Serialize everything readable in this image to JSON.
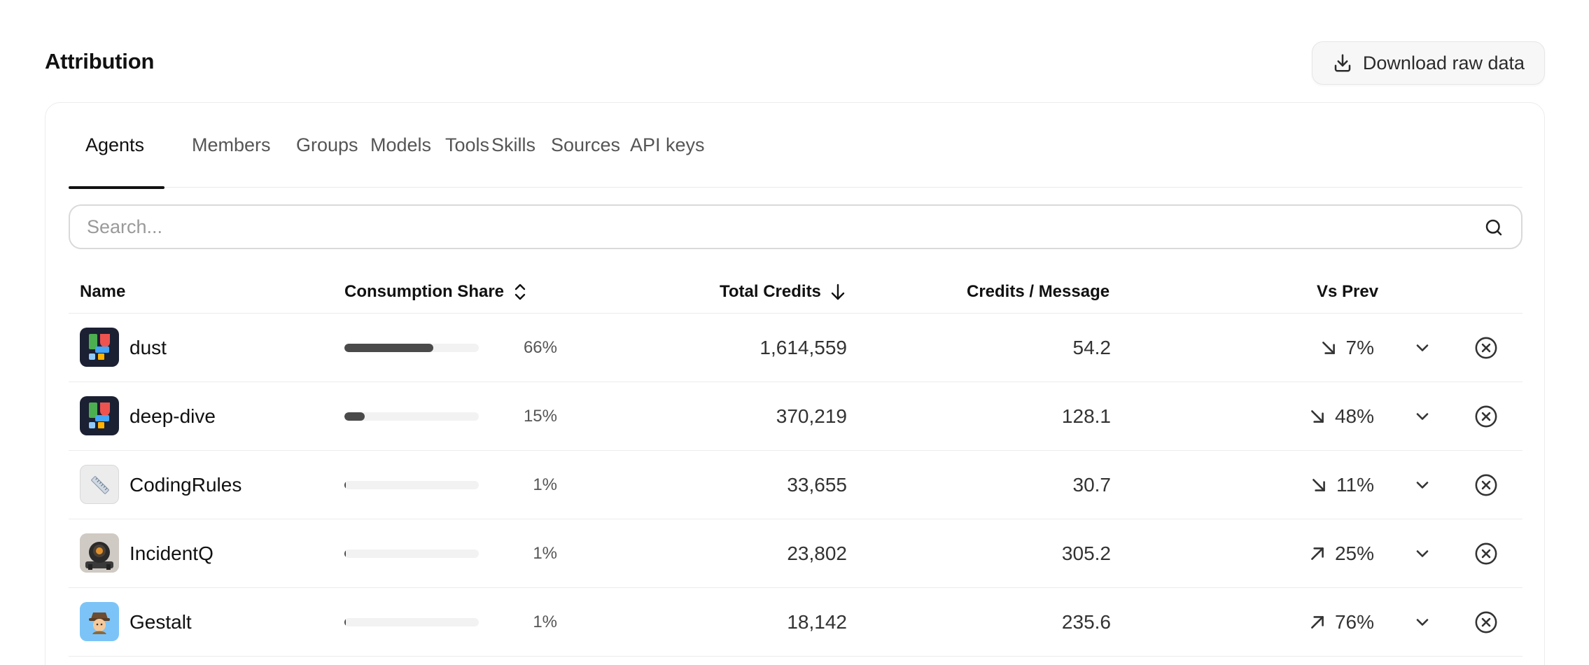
{
  "header": {
    "title": "Attribution",
    "download_label": "Download raw data"
  },
  "tabs": [
    {
      "label": "Agents",
      "active": true
    },
    {
      "label": "Members",
      "active": false
    },
    {
      "label": "Groups",
      "active": false
    },
    {
      "label": "Models",
      "active": false
    },
    {
      "label": "Tools",
      "active": false
    },
    {
      "label": "Skills",
      "active": false
    },
    {
      "label": "Sources",
      "active": false
    },
    {
      "label": "API keys",
      "active": false
    }
  ],
  "search": {
    "placeholder": "Search...",
    "value": ""
  },
  "table": {
    "columns": {
      "name": "Name",
      "share": "Consumption Share",
      "credits": "Total Credits",
      "cpm": "Credits / Message",
      "vs": "Vs Prev"
    },
    "sort": {
      "column": "Total Credits",
      "direction": "desc"
    },
    "rows": [
      {
        "name": "dust",
        "avatar": "dust-logo",
        "share_pct": 66,
        "share": "66%",
        "credits": "1,614,559",
        "cpm": "54.2",
        "trend": "down",
        "vs": "7%"
      },
      {
        "name": "deep-dive",
        "avatar": "dust-logo",
        "share_pct": 15,
        "share": "15%",
        "credits": "370,219",
        "cpm": "128.1",
        "trend": "down",
        "vs": "48%"
      },
      {
        "name": "CodingRules",
        "avatar": "ruler-emoji",
        "share_pct": 1,
        "share": "1%",
        "credits": "33,655",
        "cpm": "30.7",
        "trend": "down",
        "vs": "11%"
      },
      {
        "name": "IncidentQ",
        "avatar": "robot-photo",
        "share_pct": 1,
        "share": "1%",
        "credits": "23,802",
        "cpm": "305.2",
        "trend": "up",
        "vs": "25%"
      },
      {
        "name": "Gestalt",
        "avatar": "detective-emoji",
        "share_pct": 1,
        "share": "1%",
        "credits": "18,142",
        "cpm": "235.6",
        "trend": "up",
        "vs": "76%"
      }
    ]
  },
  "colors": {
    "bar_fill": "#4a4a4a",
    "bar_track": "#f2f2f2",
    "accent": "#111111",
    "dust_bg": "#1b2033",
    "gestalt_bg": "#7cc4f7"
  }
}
